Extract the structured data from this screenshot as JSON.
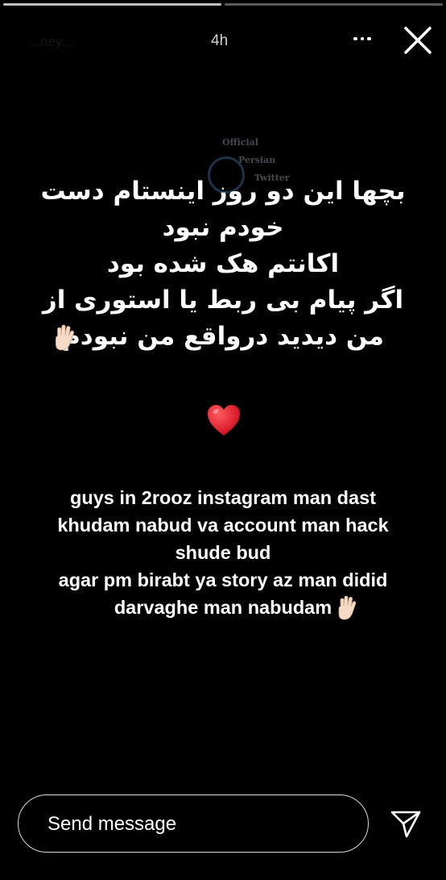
{
  "story": {
    "username": "...ney...",
    "time_ago": "4h",
    "progress_segments": 2,
    "progress_current": 1
  },
  "watermark": {
    "line1": "Official",
    "line2": "Persian",
    "line3": "Twitter"
  },
  "content": {
    "persian_text": "بچها این دو روز اینستام دست\nخودم نبود\nاکانتم هک شده بود\nاگر پیام بی ربط یا استوری از\nمن دیدید درواقع من نبودم",
    "english_text": "guys in 2rooz instagram man dast\nkhudam nabud va account man hack\nshude bud\nagar pm birabt ya story az man didid\ndarvaghe man nabudam",
    "heart_emoji": "heart-icon",
    "hand_emoji": "raised-hand-icon"
  },
  "reply": {
    "placeholder": "Send message"
  },
  "colors": {
    "background": "#000000",
    "text": "#ffffff",
    "heart": "#e0162b"
  }
}
